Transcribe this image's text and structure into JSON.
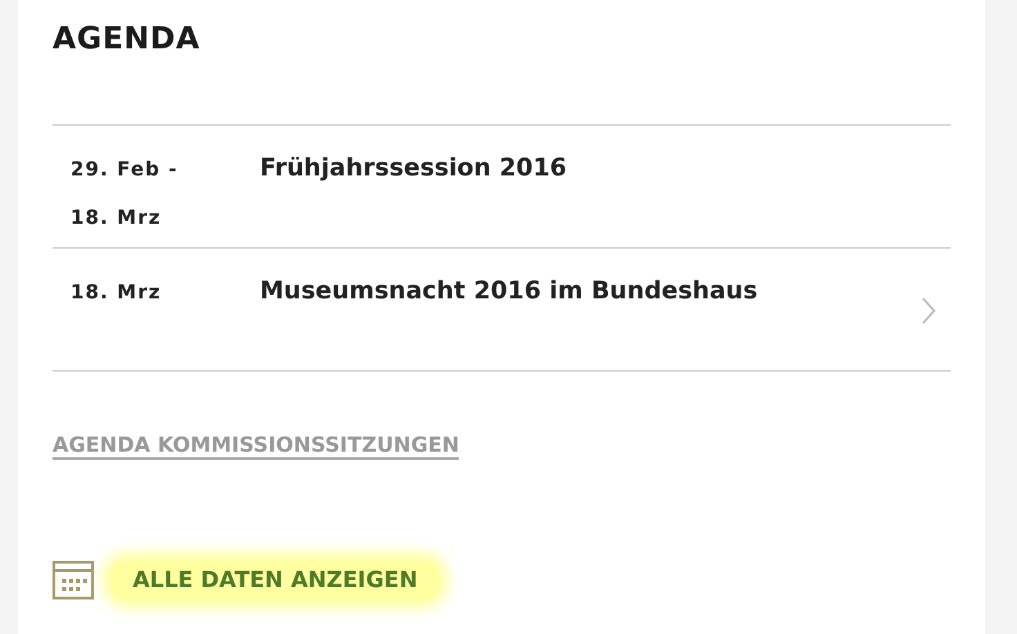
{
  "title": "AGENDA",
  "events": [
    {
      "date": "29. Feb - 18. Mrz",
      "title": "Frühjahrssession 2016",
      "chevron": false
    },
    {
      "date": "18. Mrz",
      "title": "Museumsnacht 2016 im Bundeshaus",
      "chevron": true
    }
  ],
  "commission_link": "AGENDA KOMMISSIONSSITZUNGEN",
  "all_dates_button": "ALLE DATEN ANZEIGEN"
}
